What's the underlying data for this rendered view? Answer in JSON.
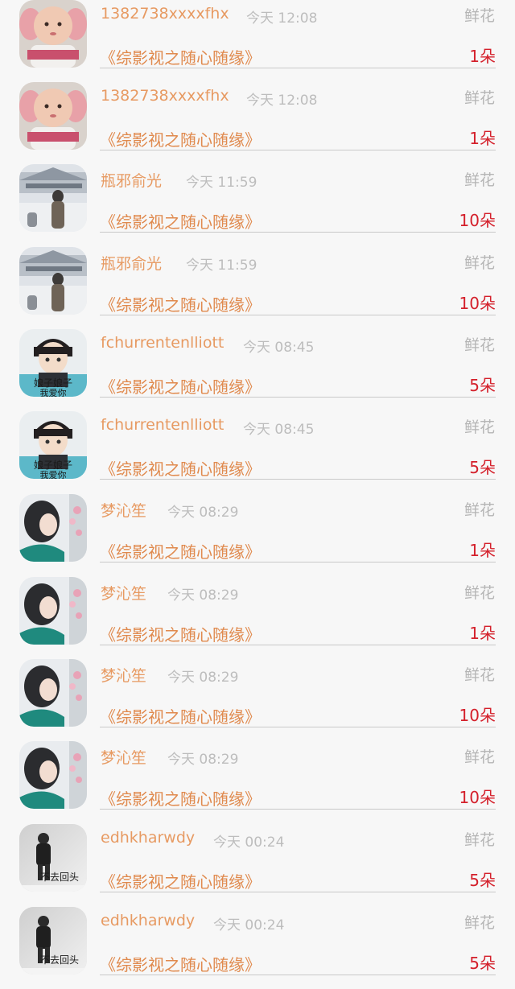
{
  "gift_records": [
    {
      "user": "1382738xxxxfhx",
      "time": "今天 12:08",
      "gift_type": "鲜花",
      "work": "《综影视之随心随缘》",
      "count": "1朵",
      "avatar": "baby-avatar"
    },
    {
      "user": "1382738xxxxfhx",
      "time": "今天 12:08",
      "gift_type": "鲜花",
      "work": "《综影视之随心随缘》",
      "count": "1朵",
      "avatar": "baby-avatar"
    },
    {
      "user": "瓶邪俞光",
      "time": "今天 11:59",
      "gift_type": "鲜花",
      "work": "《综影视之随心随缘》",
      "count": "10朵",
      "avatar": "snow-palace-avatar"
    },
    {
      "user": "瓶邪俞光",
      "time": "今天 11:59",
      "gift_type": "鲜花",
      "work": "《综影视之随心随缘》",
      "count": "10朵",
      "avatar": "snow-palace-avatar"
    },
    {
      "user": "fchurrentenlliott",
      "time": "今天 08:45",
      "gift_type": "鲜花",
      "work": "《综影视之随心随缘》",
      "count": "5朵",
      "avatar": "anime-boy-avatar",
      "avatar_caption": "娘子娘子 我爱你"
    },
    {
      "user": "fchurrentenlliott",
      "time": "今天 08:45",
      "gift_type": "鲜花",
      "work": "《综影视之随心随缘》",
      "count": "5朵",
      "avatar": "anime-boy-avatar",
      "avatar_caption": "娘子娘子 我爱你"
    },
    {
      "user": "梦沁笙",
      "time": "今天 08:29",
      "gift_type": "鲜花",
      "work": "《综影视之随心随缘》",
      "count": "1朵",
      "avatar": "girl-flowers-avatar"
    },
    {
      "user": "梦沁笙",
      "time": "今天 08:29",
      "gift_type": "鲜花",
      "work": "《综影视之随心随缘》",
      "count": "1朵",
      "avatar": "girl-flowers-avatar"
    },
    {
      "user": "梦沁笙",
      "time": "今天 08:29",
      "gift_type": "鲜花",
      "work": "《综影视之随心随缘》",
      "count": "10朵",
      "avatar": "girl-flowers-avatar"
    },
    {
      "user": "梦沁笙",
      "time": "今天 08:29",
      "gift_type": "鲜花",
      "work": "《综影视之随心随缘》",
      "count": "10朵",
      "avatar": "girl-flowers-avatar"
    },
    {
      "user": "edhkharwdy",
      "time": "今天 00:24",
      "gift_type": "鲜花",
      "work": "《综影视之随心随缘》",
      "count": "5朵",
      "avatar": "walking-man-avatar",
      "avatar_caption": "不去回头"
    },
    {
      "user": "edhkharwdy",
      "time": "今天 00:24",
      "gift_type": "鲜花",
      "work": "《综影视之随心随缘》",
      "count": "5朵",
      "avatar": "walking-man-avatar",
      "avatar_caption": "不去回头"
    }
  ],
  "colors": {
    "username": "#e79a62",
    "time": "#bdbdbd",
    "gift_type": "#b5b5b5",
    "work_title": "#e08a4e",
    "count": "#d4202b",
    "background": "#f7f7f7"
  }
}
